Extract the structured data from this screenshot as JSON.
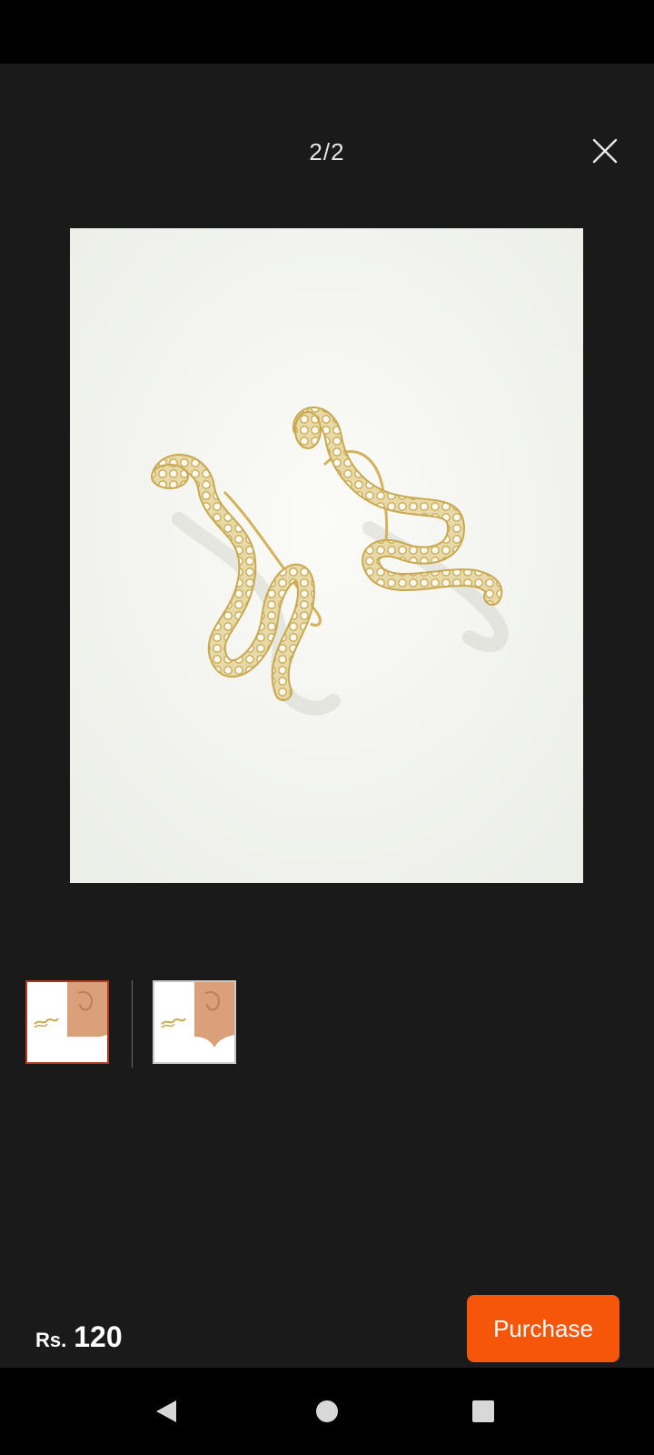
{
  "viewer": {
    "counter": "2/2",
    "close_icon": "close-icon",
    "background_color": "#1a1a1a"
  },
  "main_image": {
    "description_icon": "snake-earrings-image"
  },
  "thumbnails": [
    {
      "selected": true,
      "border_color": "#b23a1c"
    },
    {
      "selected": false,
      "border_color": "#c8c8c8"
    }
  ],
  "price": {
    "currency": "Rs.",
    "amount": "120"
  },
  "purchase": {
    "label": "Purchase",
    "color": "#f5560a"
  },
  "nav_bar": {
    "back_icon": "back-triangle-icon",
    "home_icon": "home-circle-icon",
    "recents_icon": "recents-square-icon"
  }
}
